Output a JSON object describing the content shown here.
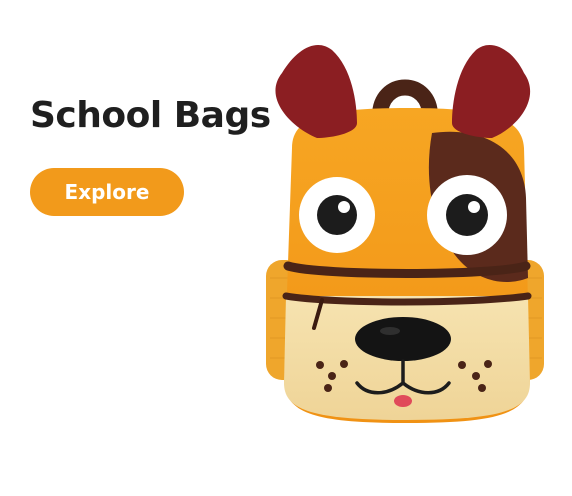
{
  "hero": {
    "title": "School Bags",
    "cta_label": "Explore"
  },
  "product_image": {
    "icon": "dog-backpack-image",
    "alt": "School Bags"
  },
  "colors": {
    "accent": "#F29A1B",
    "heading_text": "#1F1F1F",
    "button_text": "#FFFFFF"
  }
}
